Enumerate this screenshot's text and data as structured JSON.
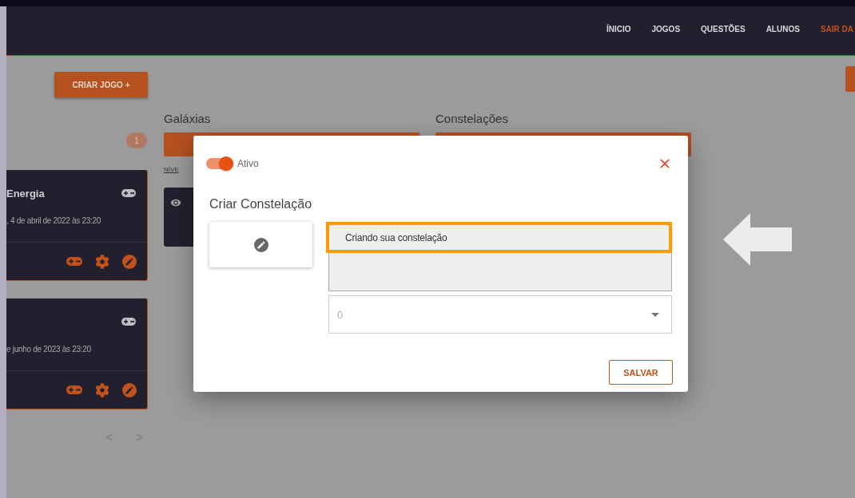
{
  "nav": {
    "links": [
      {
        "label": "ÍNICIO",
        "kind": "link"
      },
      {
        "label": "JOGOS",
        "kind": "link"
      },
      {
        "label": "QUESTÕES",
        "kind": "link"
      },
      {
        "label": "ALUNOS",
        "kind": "link"
      },
      {
        "label": "SAIR DA",
        "kind": "exit"
      }
    ]
  },
  "create_button": "CRIAR JOGO +",
  "badge": "1",
  "games": [
    {
      "title": "Energia",
      "date": ", 4 de abril de 2022 às 23:20"
    },
    {
      "date": "e junho de 2023 às 23:20"
    }
  ],
  "columns": [
    {
      "title": "Galáxias",
      "caption": "NÍVE"
    },
    {
      "title": "Constelações"
    }
  ],
  "pager": {
    "prev": "<",
    "next": ">"
  },
  "modal": {
    "toggle": {
      "label": "Ativo",
      "on": true
    },
    "title": "Criar Constelação",
    "fields": [
      {
        "kind": "text",
        "value": "Criando sua constelação",
        "highlighted": true
      },
      {
        "kind": "textarea",
        "highlighted": false
      },
      {
        "kind": "select",
        "value": "0",
        "highlighted": false
      }
    ],
    "save": "SALVAR"
  }
}
